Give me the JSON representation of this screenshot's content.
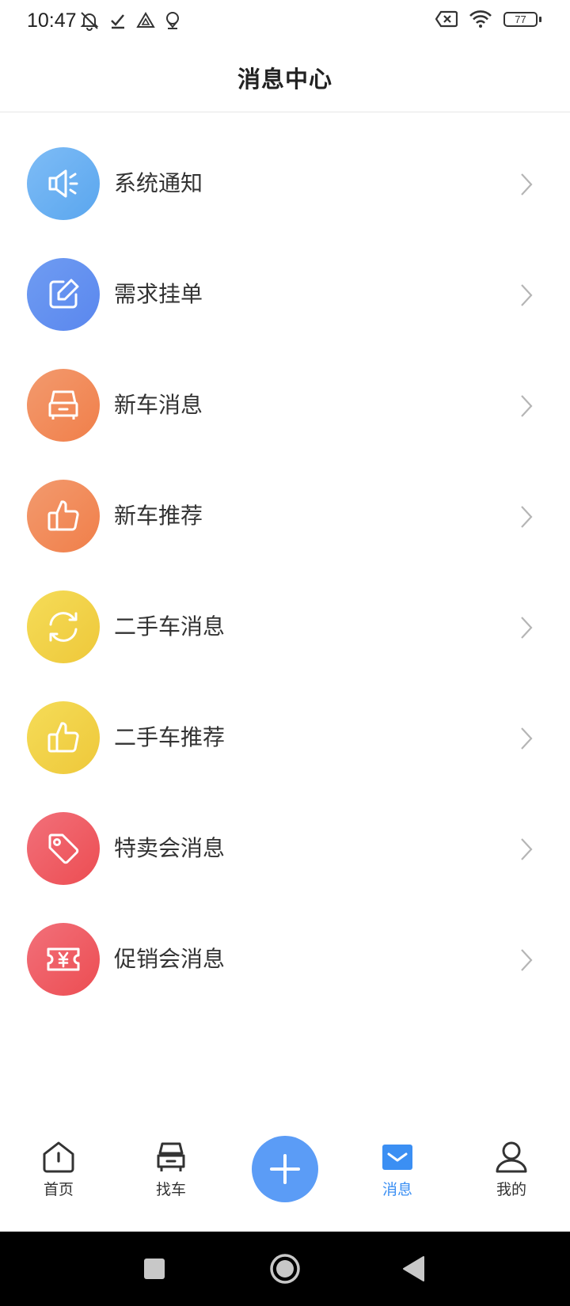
{
  "status_bar": {
    "time": "10:47",
    "battery": "77"
  },
  "header": {
    "title": "消息中心"
  },
  "messages": [
    {
      "label": "系统通知",
      "icon": "megaphone-icon",
      "color": "#6ab2f2"
    },
    {
      "label": "需求挂单",
      "icon": "edit-icon",
      "color": "#6590f0"
    },
    {
      "label": "新车消息",
      "icon": "car-icon",
      "color": "#f28a5a"
    },
    {
      "label": "新车推荐",
      "icon": "thumbs-up-icon",
      "color": "#f28a5a"
    },
    {
      "label": "二手车消息",
      "icon": "refresh-icon",
      "color": "#f2d24a"
    },
    {
      "label": "二手车推荐",
      "icon": "thumbs-up-icon",
      "color": "#f2d24a"
    },
    {
      "label": "特卖会消息",
      "icon": "tag-icon",
      "color": "#ef5d64"
    },
    {
      "label": "促销会消息",
      "icon": "coupon-icon",
      "color": "#ef5d64"
    }
  ],
  "tabs": [
    {
      "label": "首页",
      "icon": "home-icon",
      "active": false
    },
    {
      "label": "找车",
      "icon": "car-icon",
      "active": false
    },
    {
      "label": "",
      "icon": "plus-icon",
      "active": false
    },
    {
      "label": "消息",
      "icon": "mail-icon",
      "active": true
    },
    {
      "label": "我的",
      "icon": "user-icon",
      "active": false
    }
  ],
  "colors": {
    "accent": "#3b8ff3",
    "add_button": "#5b9cf6"
  }
}
